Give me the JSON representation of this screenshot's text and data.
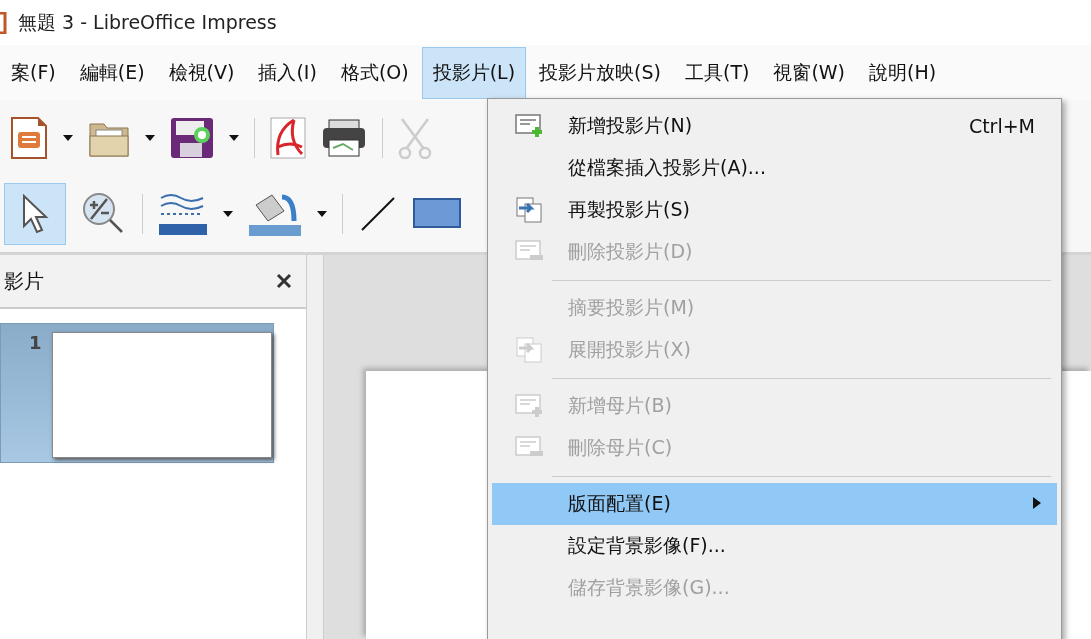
{
  "window": {
    "title": "無題 3 - LibreOffice Impress"
  },
  "menubar": [
    {
      "label": "案(F)",
      "selected": false
    },
    {
      "label": "編輯(E)",
      "selected": false
    },
    {
      "label": "檢視(V)",
      "selected": false
    },
    {
      "label": "插入(I)",
      "selected": false
    },
    {
      "label": "格式(O)",
      "selected": false
    },
    {
      "label": "投影片(L)",
      "selected": true
    },
    {
      "label": "投影片放映(S)",
      "selected": false
    },
    {
      "label": "工具(T)",
      "selected": false
    },
    {
      "label": "視窗(W)",
      "selected": false
    },
    {
      "label": "說明(H)",
      "selected": false
    }
  ],
  "slide_panel": {
    "title": "影片",
    "slides": [
      {
        "number": "1",
        "selected": true
      }
    ]
  },
  "dropdown": [
    {
      "kind": "item",
      "label": "新增投影片(N)",
      "shortcut": "Ctrl+M",
      "disabled": false,
      "selected": false
    },
    {
      "kind": "item",
      "label": "從檔案插入投影片(A)...",
      "disabled": false,
      "selected": false
    },
    {
      "kind": "item",
      "label": "再製投影片(S)",
      "disabled": false,
      "selected": false
    },
    {
      "kind": "item",
      "label": "刪除投影片(D)",
      "disabled": true,
      "selected": false
    },
    {
      "kind": "separator"
    },
    {
      "kind": "item",
      "label": "摘要投影片(M)",
      "disabled": true,
      "selected": false
    },
    {
      "kind": "item",
      "label": "展開投影片(X)",
      "disabled": true,
      "selected": false
    },
    {
      "kind": "separator"
    },
    {
      "kind": "item",
      "label": "新增母片(B)",
      "disabled": true,
      "selected": false
    },
    {
      "kind": "item",
      "label": "刪除母片(C)",
      "disabled": true,
      "selected": false
    },
    {
      "kind": "separator"
    },
    {
      "kind": "submenu",
      "label": "版面配置(E)",
      "disabled": false,
      "selected": true
    },
    {
      "kind": "item",
      "label": "設定背景影像(F)...",
      "disabled": false,
      "selected": false
    },
    {
      "kind": "item",
      "label": "儲存背景影像(G)...",
      "disabled": true,
      "selected": false
    }
  ]
}
